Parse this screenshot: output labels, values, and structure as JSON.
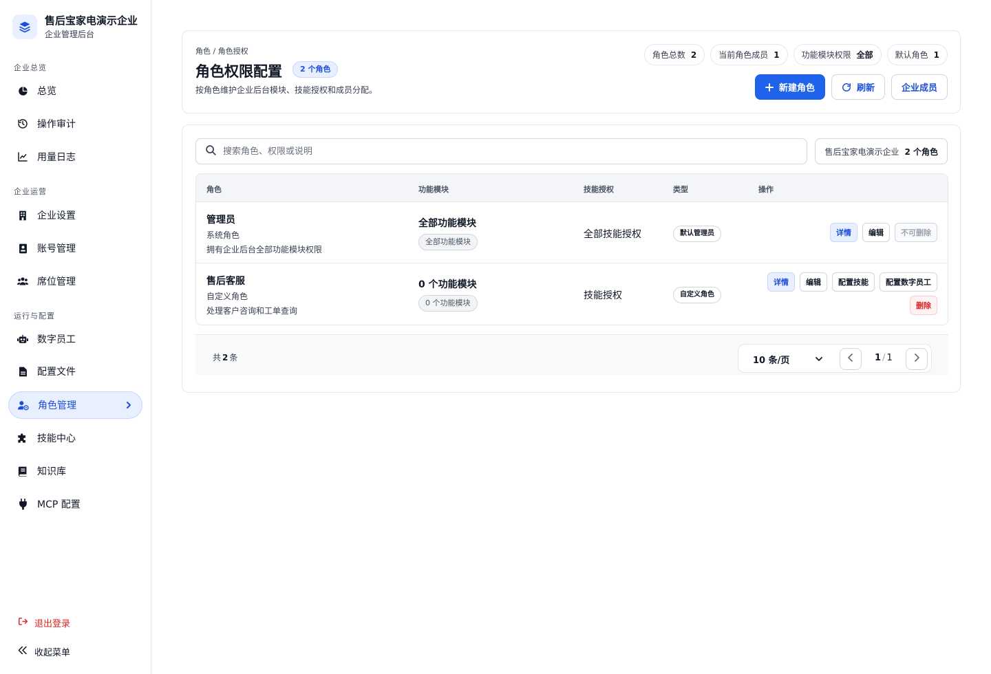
{
  "brand": {
    "name": "售后宝家电演示企业",
    "subtitle": "企业管理后台"
  },
  "sidebar": {
    "sections": [
      {
        "title": "企业总览"
      },
      {
        "title": "企业运营"
      },
      {
        "title": "运行与配置"
      }
    ],
    "items": [
      {
        "label": "总览",
        "icon": "pie-chart-icon"
      },
      {
        "label": "操作审计",
        "icon": "history-icon"
      },
      {
        "label": "用量日志",
        "icon": "line-chart-icon"
      },
      {
        "label": "企业设置",
        "icon": "building-icon"
      },
      {
        "label": "账号管理",
        "icon": "id-badge-icon"
      },
      {
        "label": "席位管理",
        "icon": "users-icon"
      },
      {
        "label": "数字员工",
        "icon": "robot-icon"
      },
      {
        "label": "配置文件",
        "icon": "file-icon"
      },
      {
        "label": "角色管理",
        "icon": "user-role-icon",
        "active": true
      },
      {
        "label": "技能中心",
        "icon": "puzzle-icon"
      },
      {
        "label": "知识库",
        "icon": "book-icon"
      },
      {
        "label": "MCP 配置",
        "icon": "plug-icon"
      }
    ],
    "logout": "退出登录",
    "collapse": "收起菜单"
  },
  "header": {
    "breadcrumb": "角色 / 角色授权",
    "title": "角色权限配置",
    "count_badge": "2 个角色",
    "description": "按角色维护企业后台模块、技能授权和成员分配。",
    "stats": [
      {
        "label": "角色总数",
        "value": "2"
      },
      {
        "label": "当前角色成员",
        "value": "1"
      },
      {
        "label": "功能模块权限",
        "value": "全部"
      },
      {
        "label": "默认角色",
        "value": "1"
      }
    ],
    "buttons": {
      "new_role": "新建角色",
      "refresh": "刷新",
      "members": "企业成员"
    }
  },
  "search": {
    "placeholder": "搜索角色、权限或说明",
    "value": ""
  },
  "org_filter": {
    "name": "售后宝家电演示企业",
    "count": "2 个角色"
  },
  "table": {
    "columns": [
      "角色",
      "功能模块",
      "技能授权",
      "类型",
      "操作"
    ],
    "rows": [
      {
        "name": "管理员",
        "kind": "系统角色",
        "desc": "拥有企业后台全部功能模块权限",
        "module_title": "全部功能模块",
        "module_tag": "全部功能模块",
        "skill": "全部技能授权",
        "type": "默认管理员",
        "actions": {
          "detail": "详情",
          "edit": "编辑",
          "no_delete": "不可删除"
        }
      },
      {
        "name": "售后客服",
        "kind": "自定义角色",
        "desc": "处理客户咨询和工单查询",
        "module_title": "0 个功能模块",
        "module_tag": "0 个功能模块",
        "skill": "技能授权",
        "type": "自定义角色",
        "actions": {
          "detail": "详情",
          "edit": "编辑",
          "skills": "配置技能",
          "digital": "配置数字员工",
          "delete": "删除"
        }
      }
    ]
  },
  "pagination": {
    "total_prefix": "共",
    "total": "2",
    "total_suffix": "条",
    "page_size": "10 条/页",
    "current": "1",
    "pages": "1"
  },
  "colors": {
    "accent": "#1e63e9",
    "accent_soft": "#e8efff",
    "danger": "#dc2626"
  }
}
